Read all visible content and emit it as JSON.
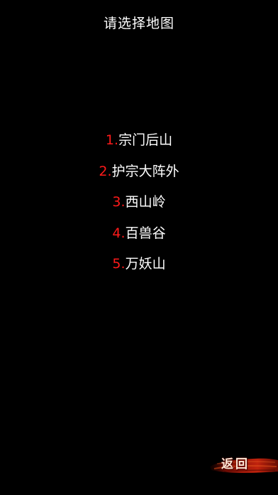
{
  "header": {
    "title": "请选择地图"
  },
  "maps": [
    {
      "number": "1.",
      "name": "宗门后山"
    },
    {
      "number": "2.",
      "name": "护宗大阵外"
    },
    {
      "number": "3.",
      "name": "西山岭"
    },
    {
      "number": "4.",
      "name": "百兽谷"
    },
    {
      "number": "5.",
      "name": "万妖山"
    }
  ],
  "footer": {
    "back_label": "返回"
  },
  "colors": {
    "background": "#000000",
    "number_accent": "#ff1a1a",
    "text": "#ffffff",
    "back_brush": "#b51a0a"
  }
}
